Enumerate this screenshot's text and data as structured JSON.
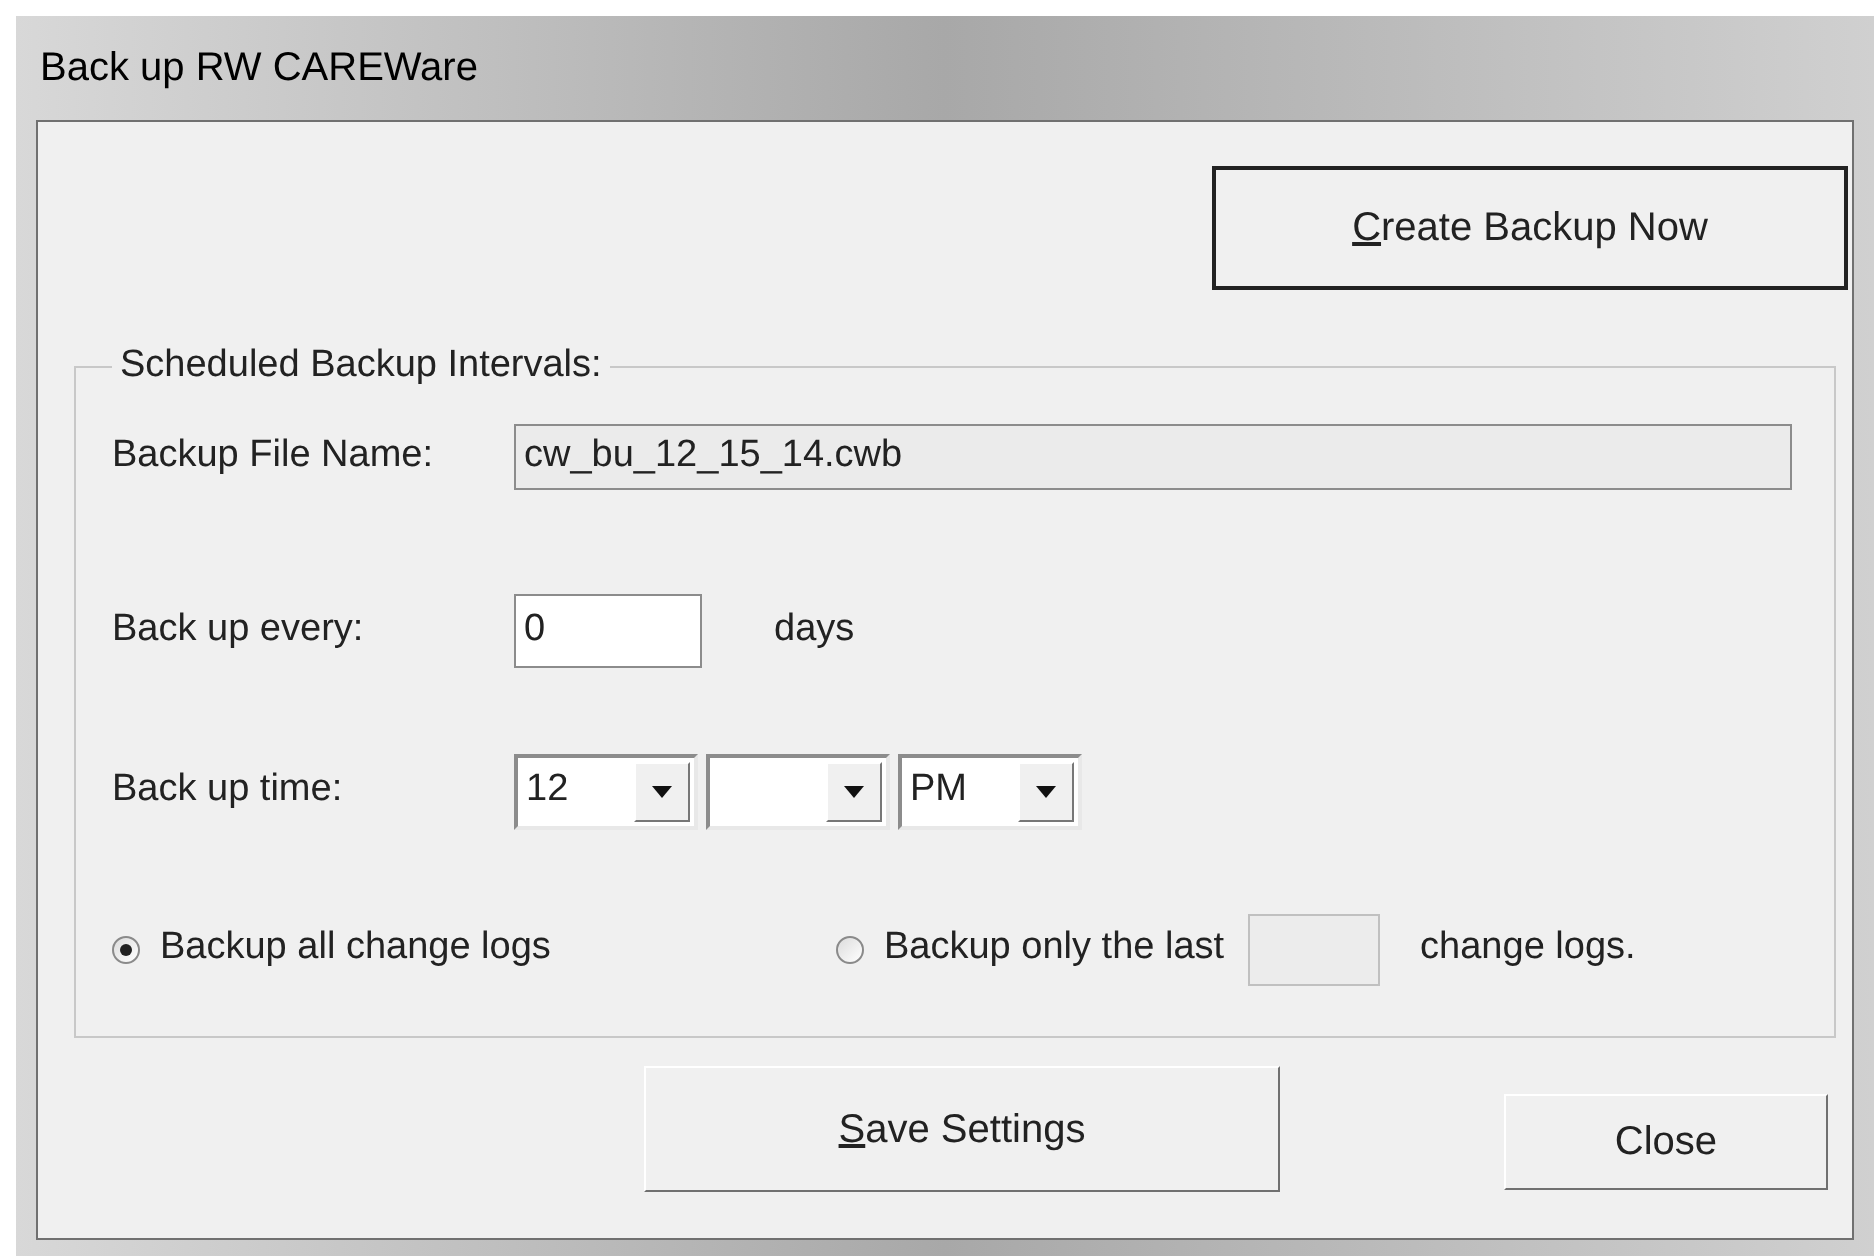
{
  "window": {
    "title": "Back up RW CAREWare"
  },
  "create_button": {
    "label_parts": [
      "C",
      "reate Backup Now"
    ]
  },
  "group": {
    "title": "Scheduled Backup Intervals:",
    "file_name": {
      "label": "Backup File Name:",
      "value": "cw_bu_12_15_14.cwb",
      "disabled": true
    },
    "every": {
      "label": "Back up every:",
      "value": "0",
      "unit": "days"
    },
    "time": {
      "label": "Back up time:",
      "combos": [
        {
          "kind": "filled",
          "value": "12"
        },
        {
          "kind": "blank"
        },
        {
          "kind": "filled",
          "value": "PM"
        }
      ]
    },
    "options": [
      {
        "kind": "plain",
        "label": "Backup all change logs",
        "selected": true
      },
      {
        "kind": "count",
        "label": "Backup only the last",
        "suffix": "change logs.",
        "selected": false
      }
    ]
  },
  "save_button": {
    "label_parts": [
      "S",
      "ave Settings"
    ]
  },
  "close_button": {
    "label": "Close"
  }
}
